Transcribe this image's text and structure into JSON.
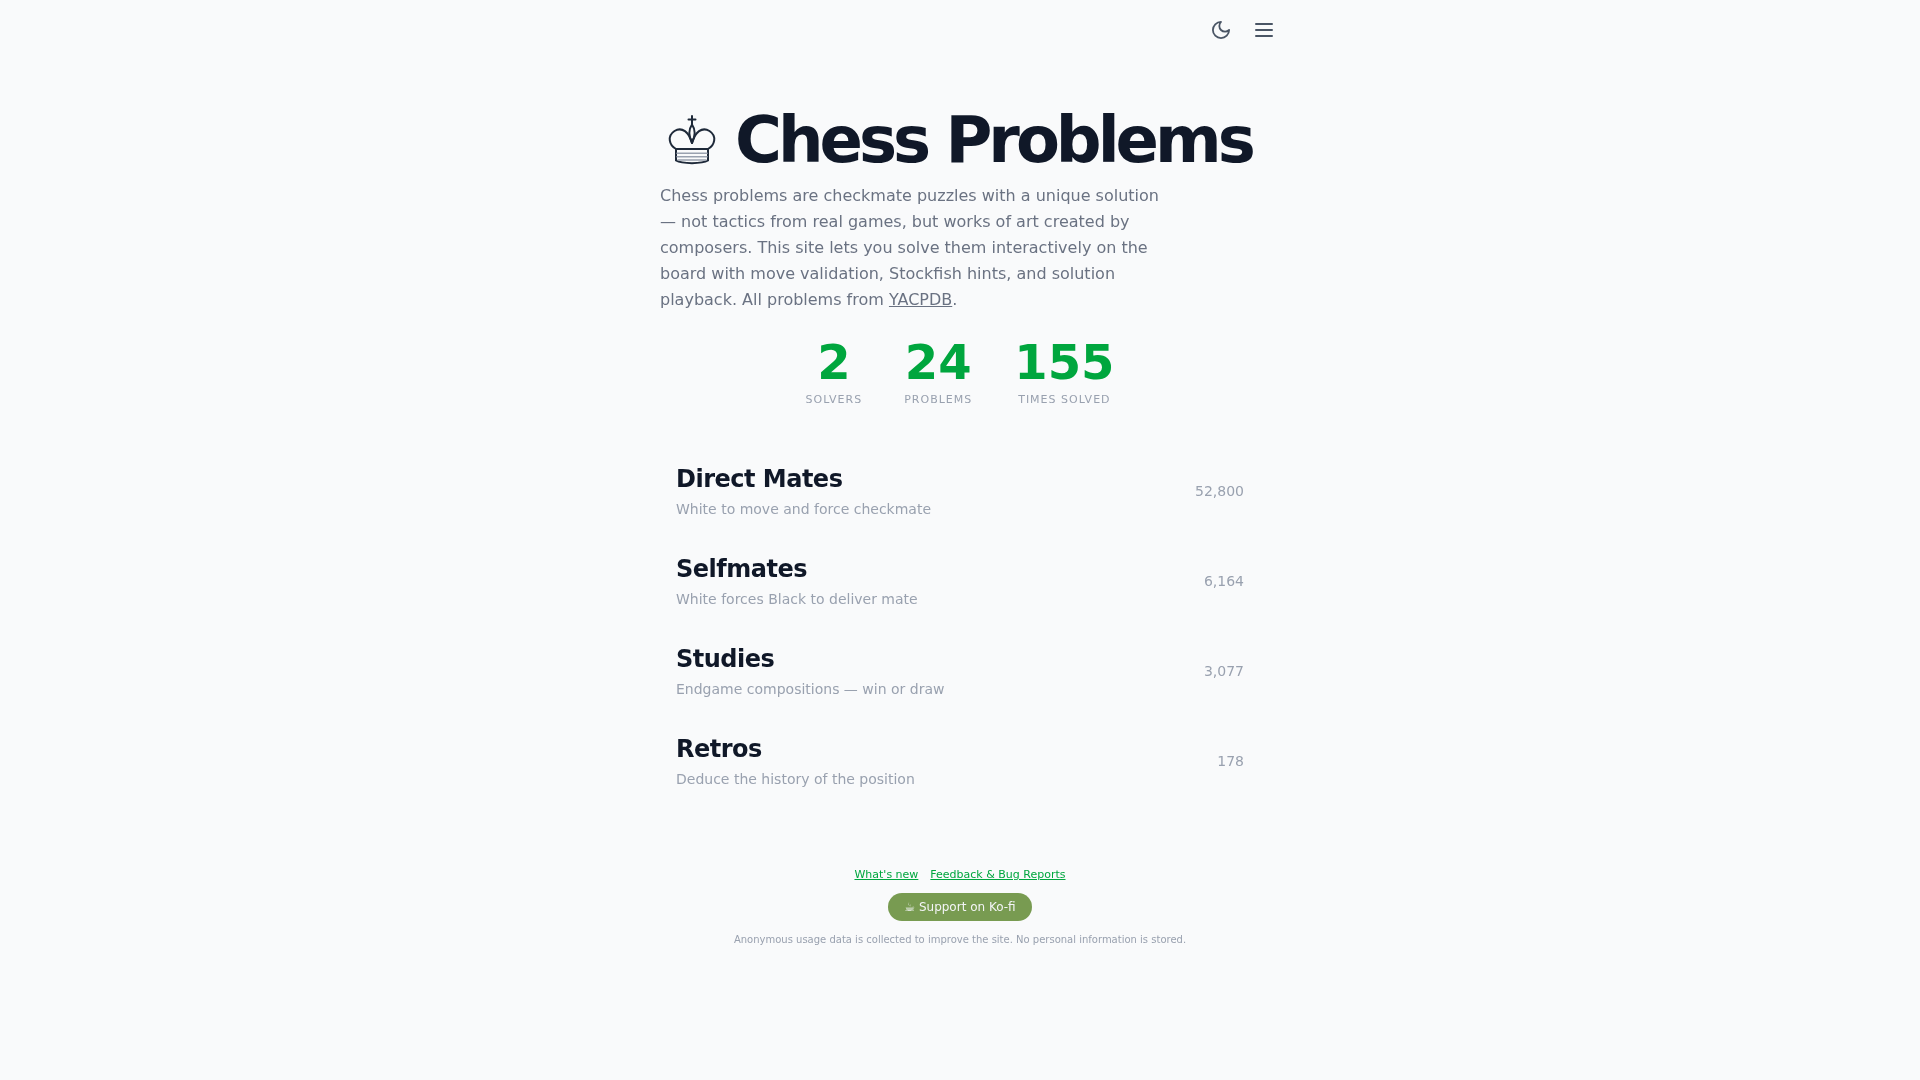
{
  "header": {
    "title": "Chess Problems"
  },
  "intro": {
    "text": "Chess problems are checkmate puzzles with a unique solution — not tactics from real games, but works of art created by composers. This site lets you solve them interactively on the board with move validation, Stockfish hints, and solution playback. All problems from ",
    "link": "YACPDB",
    "after_link": "."
  },
  "stats": [
    {
      "value": "2",
      "label": "SOLVERS"
    },
    {
      "value": "24",
      "label": "PROBLEMS"
    },
    {
      "value": "155",
      "label": "TIMES SOLVED"
    }
  ],
  "categories": [
    {
      "name": "Direct Mates",
      "description": "White to move and force checkmate",
      "count": "52,800"
    },
    {
      "name": "Selfmates",
      "description": "White forces Black to deliver mate",
      "count": "6,164"
    },
    {
      "name": "Studies",
      "description": "Endgame compositions — win or draw",
      "count": "3,077"
    },
    {
      "name": "Retros",
      "description": "Deduce the history of the position",
      "count": "178"
    }
  ],
  "footer": {
    "links": [
      "What's new",
      "Feedback & Bug Reports"
    ],
    "support_button": "☕ Support on Ko-fi",
    "notice": "Anonymous usage data is collected to improve the site. No personal information is stored."
  }
}
